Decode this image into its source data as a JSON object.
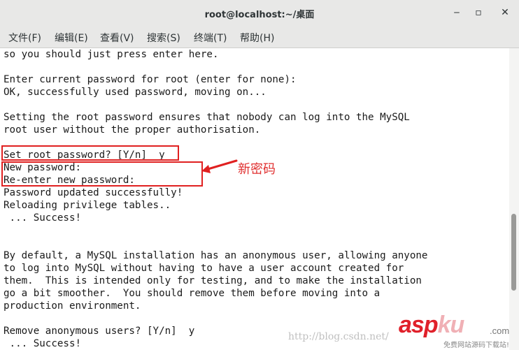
{
  "window": {
    "title": "root@localhost:~/桌面",
    "minimize_symbol": "‒",
    "maximize_symbol": "▫",
    "close_symbol": "✕"
  },
  "menu": {
    "items": [
      {
        "label": "文件(F)"
      },
      {
        "label": "编辑(E)"
      },
      {
        "label": "查看(V)"
      },
      {
        "label": "搜索(S)"
      },
      {
        "label": "终端(T)"
      },
      {
        "label": "帮助(H)"
      }
    ]
  },
  "terminal": {
    "lines": [
      "so you should just press enter here.",
      "",
      "Enter current password for root (enter for none):",
      "OK, successfully used password, moving on...",
      "",
      "Setting the root password ensures that nobody can log into the MySQL",
      "root user without the proper authorisation.",
      "",
      "Set root password? [Y/n]  y",
      "New password:",
      "Re-enter new password:",
      "Password updated successfully!",
      "Reloading privilege tables..",
      " ... Success!",
      "",
      "",
      "By default, a MySQL installation has an anonymous user, allowing anyone",
      "to log into MySQL without having to have a user account created for",
      "them.  This is intended only for testing, and to make the installation",
      "go a bit smoother.  You should remove them before moving into a",
      "production environment.",
      "",
      "Remove anonymous users? [Y/n]  y",
      " ... Success!"
    ]
  },
  "annotation": {
    "text": "新密码",
    "color": "#e03030"
  },
  "watermark": {
    "url_text": "http://blog.csdn.net/",
    "logo_asp": "asp",
    "logo_ku": "ku",
    "logo_com": ".com",
    "logo_sub": "免费网站源码下载站!"
  },
  "colors": {
    "highlight": "#e02020",
    "titlebar": "#e8e8e7"
  }
}
